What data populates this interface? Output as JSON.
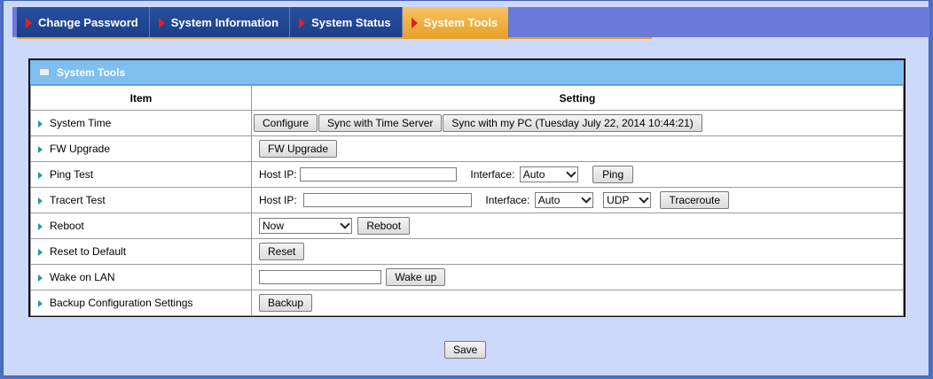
{
  "tabs": [
    {
      "label": "Change Password",
      "active": false
    },
    {
      "label": "System Information",
      "active": false
    },
    {
      "label": "System Status",
      "active": false
    },
    {
      "label": "System Tools",
      "active": true
    }
  ],
  "panel": {
    "title": "System Tools",
    "columns": {
      "item": "Item",
      "setting": "Setting"
    }
  },
  "rows": {
    "system_time": {
      "label": "System Time",
      "configure": "Configure",
      "sync_server": "Sync with Time Server",
      "sync_pc": "Sync with my PC (Tuesday July 22, 2014 10:44:21)"
    },
    "fw_upgrade": {
      "label": "FW Upgrade",
      "button": "FW Upgrade"
    },
    "ping": {
      "label": "Ping Test",
      "host_label": "Host IP:",
      "host_value": "",
      "interface_label": "Interface:",
      "interface_value": "Auto",
      "button": "Ping"
    },
    "tracert": {
      "label": "Tracert Test",
      "host_label": "Host IP:",
      "host_value": "",
      "interface_label": "Interface:",
      "interface_value": "Auto",
      "protocol_value": "UDP",
      "button": "Traceroute"
    },
    "reboot": {
      "label": "Reboot",
      "when_value": "Now",
      "button": "Reboot"
    },
    "reset": {
      "label": "Reset to Default",
      "button": "Reset"
    },
    "wol": {
      "label": "Wake on LAN",
      "input_value": "",
      "button": "Wake up"
    },
    "backup": {
      "label": "Backup Configuration Settings",
      "button": "Backup"
    }
  },
  "footer": {
    "save": "Save"
  },
  "colors": {
    "tab_bg": "#1d3f88",
    "tab_active": "#e8a22a",
    "panel_header": "#7ebff0",
    "page_bg": "#cdd9fb"
  }
}
